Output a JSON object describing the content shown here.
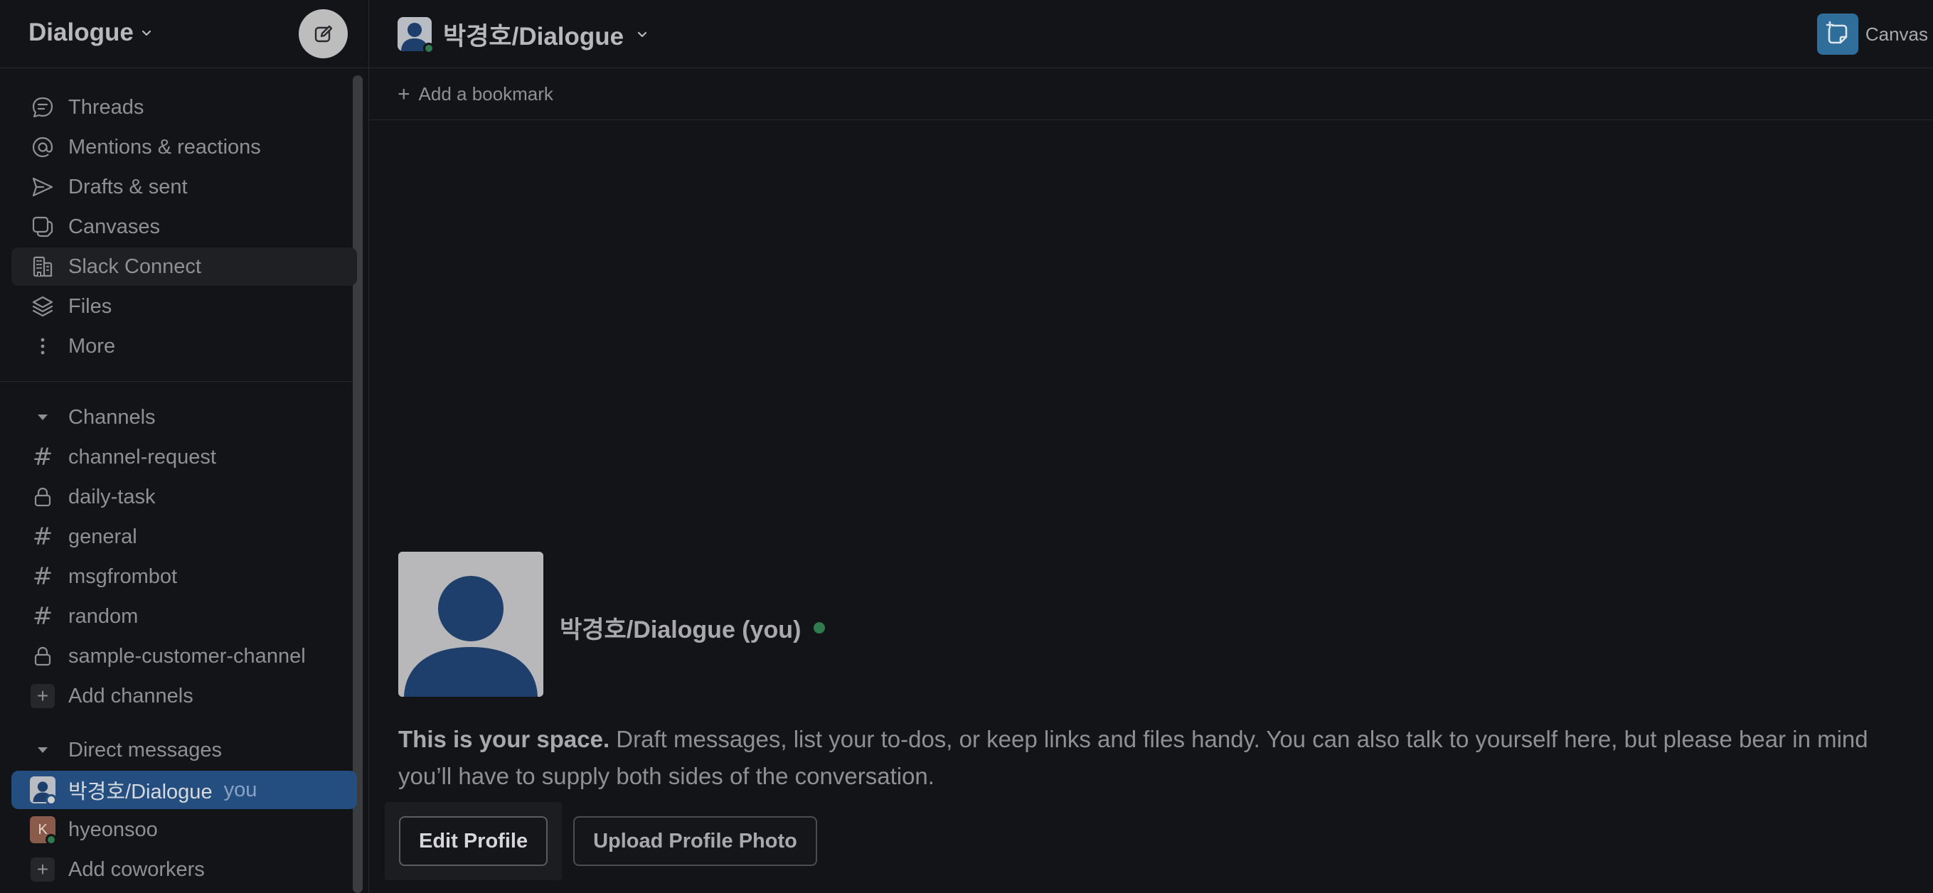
{
  "workspace": {
    "name": "Dialogue"
  },
  "sidebar": {
    "nav": [
      {
        "label": "Threads",
        "icon": "threads-icon"
      },
      {
        "label": "Mentions & reactions",
        "icon": "at-icon"
      },
      {
        "label": "Drafts & sent",
        "icon": "send-icon"
      },
      {
        "label": "Canvases",
        "icon": "canvases-icon"
      },
      {
        "label": "Slack Connect",
        "icon": "building-icon"
      },
      {
        "label": "Files",
        "icon": "layers-icon"
      },
      {
        "label": "More",
        "icon": "more-vertical-icon"
      }
    ],
    "channels_header": "Channels",
    "channels": [
      {
        "name": "channel-request",
        "type": "public"
      },
      {
        "name": "daily-task",
        "type": "private"
      },
      {
        "name": "general",
        "type": "public"
      },
      {
        "name": "msgfrombot",
        "type": "public"
      },
      {
        "name": "random",
        "type": "public"
      },
      {
        "name": "sample-customer-channel",
        "type": "private"
      }
    ],
    "add_channels": "Add channels",
    "dms_header": "Direct messages",
    "dms": [
      {
        "name": "박경호/Dialogue",
        "tag": "you",
        "avatar_initial": ""
      },
      {
        "name": "hyeonsoo",
        "tag": "",
        "avatar_initial": "K"
      }
    ],
    "add_coworkers": "Add coworkers"
  },
  "header": {
    "title": "박경호/Dialogue",
    "canvas_label": "Canvas"
  },
  "bookmarks": {
    "add_label": "Add a bookmark"
  },
  "profile": {
    "display_name": "박경호/Dialogue (you)",
    "intro_bold": "This is your space.",
    "intro_text": " Draft messages, list your to-dos, or keep links and files handy. You can also talk to yourself here, but please bear in mind you’ll have to supply both sides of the conversation.",
    "edit_profile": "Edit Profile",
    "upload_photo": "Upload Profile Photo"
  },
  "colors": {
    "background": "#131417",
    "active_item": "#244e80",
    "presence_online": "#2f7a4e",
    "canvas_accent": "#2f6d9b"
  }
}
